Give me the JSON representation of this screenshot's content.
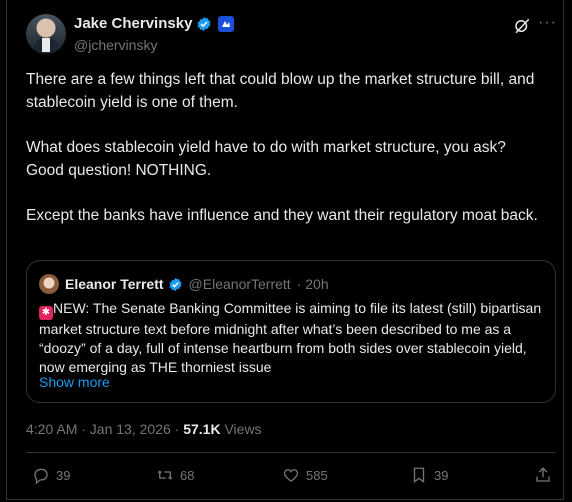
{
  "author": {
    "name": "Jake Chervinsky",
    "handle": "@jchervinsky"
  },
  "post": {
    "paragraphs": [
      "There are a few things left that could blow up the market structure bill, and stablecoin yield is one of them.",
      "What does stablecoin yield have to do with market structure, you ask? Good question! NOTHING.",
      "Except the banks have influence and they want their regulatory moat back."
    ],
    "timestamp": "4:20 AM · Jan 13, 2026 · ",
    "views_count": "57.1K",
    "views_label": " Views"
  },
  "quote": {
    "name": "Eleanor Terrett",
    "handle": "@EleanorTerrett",
    "time": "· 20h",
    "text": "NEW: The Senate Banking Committee is aiming to file its latest (still) bipartisan market structure text before midnight after what’s been described to me as a “doozy” of a day, full of intense heartburn from both sides over stablecoin yield, now emerging as THE thorniest issue",
    "show_more": "Show more"
  },
  "actions": {
    "replies": "39",
    "reposts": "68",
    "likes": "585",
    "bookmarks": "39"
  },
  "colors": {
    "background": "#000000",
    "text": "#e7e9ea",
    "muted": "#71767b",
    "accent": "#1d9bf0",
    "border": "#2f3336"
  },
  "icons": [
    "verified-badge-icon",
    "affiliate-badge-icon",
    "grok-icon",
    "more-icon",
    "reply-icon",
    "repost-icon",
    "like-icon",
    "bookmark-icon",
    "share-icon",
    "siren-icon"
  ]
}
